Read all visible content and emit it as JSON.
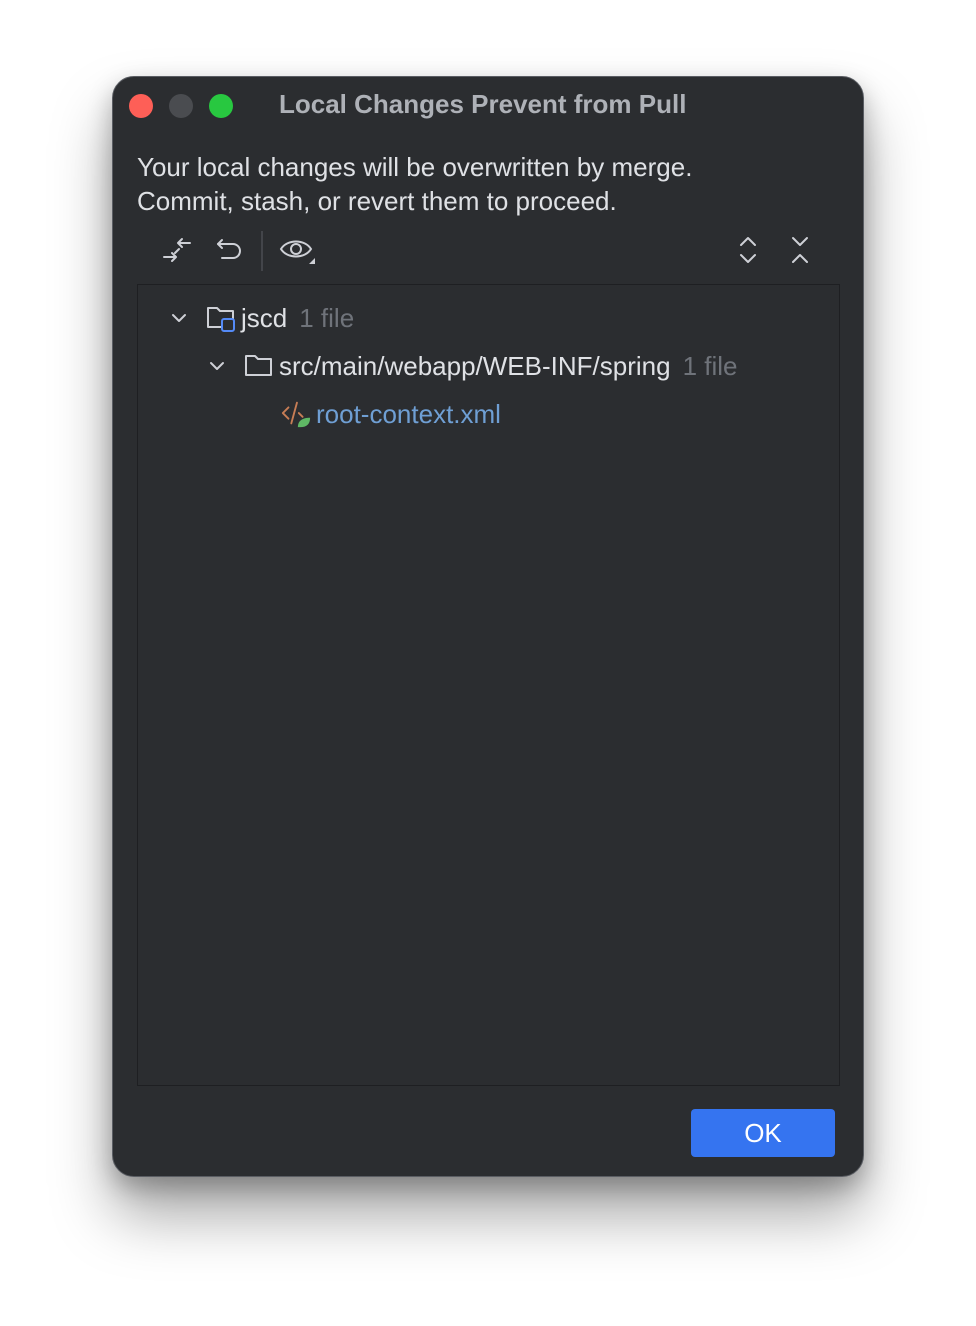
{
  "window": {
    "title": "Local Changes Prevent from Pull"
  },
  "message": {
    "line1": "Your local changes will be overwritten by merge.",
    "line2": "Commit, stash, or revert them to proceed."
  },
  "toolbar": {
    "icons": [
      "compare-icon",
      "rollback-icon",
      "view-options-icon",
      "expand-all-icon",
      "collapse-all-icon"
    ]
  },
  "tree": {
    "root": {
      "name": "jscd",
      "count": "1 file",
      "icon": "module-folder-icon"
    },
    "folder": {
      "name": "src/main/webapp/WEB-INF/spring",
      "count": "1 file",
      "icon": "folder-icon"
    },
    "file": {
      "name": "root-context.xml",
      "icon": "spring-xml-icon",
      "color": "#6f9fd4"
    }
  },
  "buttons": {
    "ok": "OK"
  },
  "colors": {
    "accent": "#3574f0",
    "background": "#2b2d30",
    "close": "#fe5f57",
    "maximize": "#28c840"
  }
}
